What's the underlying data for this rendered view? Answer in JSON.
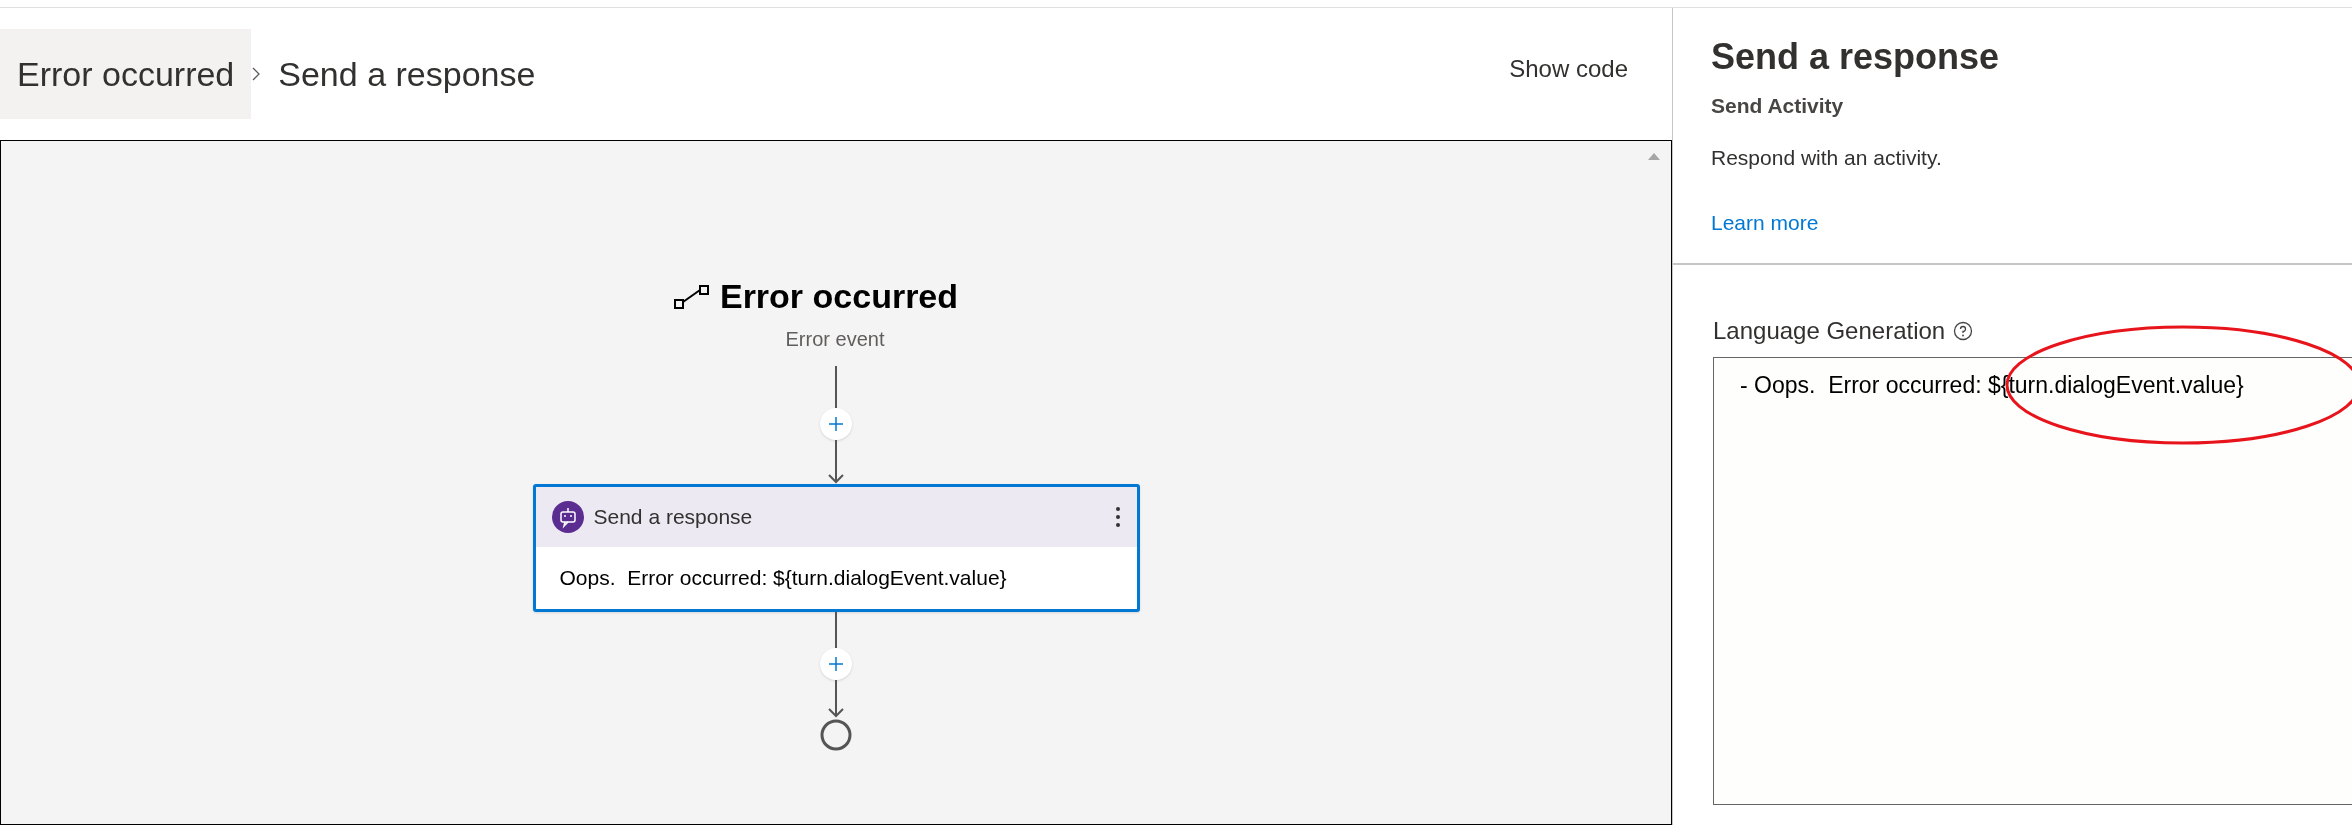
{
  "breadcrumb": [
    {
      "label": "Error occurred",
      "selected": true
    },
    {
      "label": "Send a response",
      "selected": false
    }
  ],
  "header_button": "Show code",
  "canvas": {
    "trigger": {
      "title": "Error occurred",
      "subtitle": "Error event"
    },
    "action": {
      "title": "Send a response",
      "body": "Oops.  Error occurred: ${turn.dialogEvent.value}",
      "selected": true
    }
  },
  "panel": {
    "title": "Send a response",
    "subtitle": "Send Activity",
    "description": "Respond with an activity.",
    "link": "Learn more",
    "field_label": "Language Generation",
    "field_value": "- Oops.  Error occurred: ${turn.dialogEvent.value}"
  }
}
